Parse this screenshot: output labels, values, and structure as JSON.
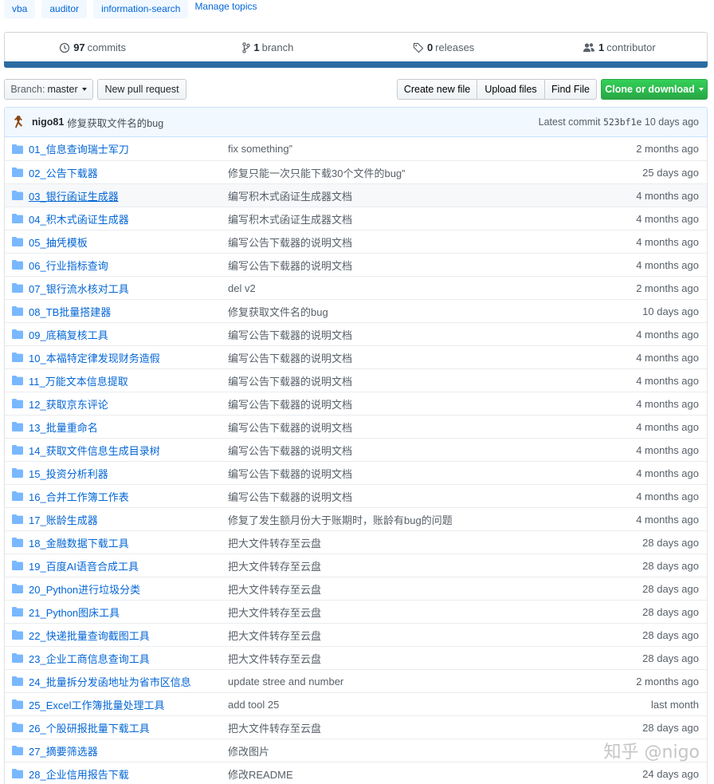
{
  "topics": [
    "vba",
    "auditor",
    "information-search"
  ],
  "manage_topics": "Manage topics",
  "summary": {
    "commits_count": "97",
    "commits_label": "commits",
    "branch_count": "1",
    "branch_label": "branch",
    "releases_count": "0",
    "releases_label": "releases",
    "contributor_count": "1",
    "contributor_label": "contributor"
  },
  "language_bar_color": "#2b6ca3",
  "toolbar": {
    "branch_prefix": "Branch:",
    "branch_name": "master",
    "new_pull_request": "New pull request",
    "create_new_file": "Create new file",
    "upload_files": "Upload files",
    "find_file": "Find File",
    "clone_or_download": "Clone or download"
  },
  "commit": {
    "author": "nigo81",
    "message": "修复获取文件名的bug",
    "latest_label": "Latest commit",
    "sha": "523bf1e",
    "age": "10 days ago"
  },
  "files": [
    {
      "name": "01_信息查询瑞士军刀",
      "message": "fix something”",
      "age": "2 months ago"
    },
    {
      "name": "02_公告下载器",
      "message": "修复只能一次只能下载30个文件的bug”",
      "age": "25 days ago"
    },
    {
      "name": "03_银行函证生成器",
      "message": "编写积木式函证生成器文档",
      "age": "4 months ago"
    },
    {
      "name": "04_积木式函证生成器",
      "message": "编写积木式函证生成器文档",
      "age": "4 months ago"
    },
    {
      "name": "05_抽凭模板",
      "message": "编写公告下载器的说明文档",
      "age": "4 months ago"
    },
    {
      "name": "06_行业指标查询",
      "message": "编写公告下载器的说明文档",
      "age": "4 months ago"
    },
    {
      "name": "07_银行流水核对工具",
      "message": "del v2",
      "age": "2 months ago"
    },
    {
      "name": "08_TB批量搭建器",
      "message": "修复获取文件名的bug",
      "age": "10 days ago"
    },
    {
      "name": "09_底稿复核工具",
      "message": "编写公告下载器的说明文档",
      "age": "4 months ago"
    },
    {
      "name": "10_本福特定律发现财务造假",
      "message": "编写公告下载器的说明文档",
      "age": "4 months ago"
    },
    {
      "name": "11_万能文本信息提取",
      "message": "编写公告下载器的说明文档",
      "age": "4 months ago"
    },
    {
      "name": "12_获取京东评论",
      "message": "编写公告下载器的说明文档",
      "age": "4 months ago"
    },
    {
      "name": "13_批量重命名",
      "message": "编写公告下载器的说明文档",
      "age": "4 months ago"
    },
    {
      "name": "14_获取文件信息生成目录树",
      "message": "编写公告下载器的说明文档",
      "age": "4 months ago"
    },
    {
      "name": "15_投资分析利器",
      "message": "编写公告下载器的说明文档",
      "age": "4 months ago"
    },
    {
      "name": "16_合并工作簿工作表",
      "message": "编写公告下载器的说明文档",
      "age": "4 months ago"
    },
    {
      "name": "17_账龄生成器",
      "message": "修复了发生额月份大于账期时，账龄有bug的问题",
      "age": "4 months ago"
    },
    {
      "name": "18_金融数据下载工具",
      "message": "把大文件转存至云盘",
      "age": "28 days ago"
    },
    {
      "name": "19_百度AI语音合成工具",
      "message": "把大文件转存至云盘",
      "age": "28 days ago"
    },
    {
      "name": "20_Python进行垃圾分类",
      "message": "把大文件转存至云盘",
      "age": "28 days ago"
    },
    {
      "name": "21_Python图床工具",
      "message": "把大文件转存至云盘",
      "age": "28 days ago"
    },
    {
      "name": "22_快递批量查询截图工具",
      "message": "把大文件转存至云盘",
      "age": "28 days ago"
    },
    {
      "name": "23_企业工商信息查询工具",
      "message": "把大文件转存至云盘",
      "age": "28 days ago"
    },
    {
      "name": "24_批量拆分发函地址为省市区信息",
      "message": "update stree and number",
      "age": "2 months ago"
    },
    {
      "name": "25_Excel工作簿批量处理工具",
      "message": "add tool 25",
      "age": "last month"
    },
    {
      "name": "26_个股研报批量下载工具",
      "message": "把大文件转存至云盘",
      "age": "28 days ago"
    },
    {
      "name": "27_摘要筛选器",
      "message": "修改图片",
      "age": ""
    },
    {
      "name": "28_企业信用报告下载",
      "message": "修改README",
      "age": "24 days ago"
    }
  ],
  "watermark": "知乎 @nigo"
}
